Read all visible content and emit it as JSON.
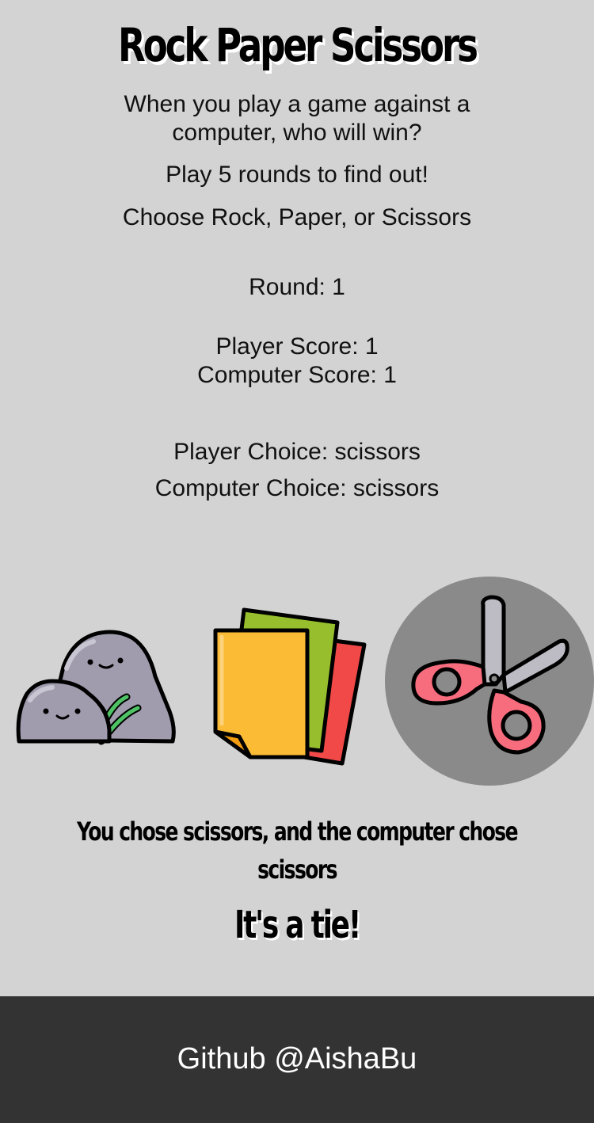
{
  "header": {
    "title": "Rock Paper Scissors",
    "intro": "When you play a game against a computer, who will win?",
    "rounds_prompt": "Play 5 rounds to find out!",
    "choose_prompt": "Choose Rock, Paper, or Scissors"
  },
  "scoreboard": {
    "round": "Round: 1",
    "player_score": "Player Score: 1",
    "computer_score": "Computer Score: 1",
    "player_choice": "Player Choice: scissors",
    "computer_choice": "Computer Choice: scissors"
  },
  "choices": [
    {
      "id": "rock",
      "icon": "rock-icon"
    },
    {
      "id": "paper",
      "icon": "paper-icon"
    },
    {
      "id": "scissors",
      "icon": "scissors-icon",
      "selected": true
    }
  ],
  "result": {
    "sentence": "You chose scissors, and the computer chose scissors",
    "verdict": "It's a tie!"
  },
  "footer": {
    "link_text": "Github @AishaBu"
  },
  "colors": {
    "background": "#d3d3d3",
    "footer": "#333333",
    "selected_halo": "#8a8a8a",
    "scissors_handle": "#f76d7e",
    "paper_front": "#fbbb34",
    "paper_green": "#97bf2d",
    "paper_red": "#f14848",
    "rock": "#a09cae"
  }
}
